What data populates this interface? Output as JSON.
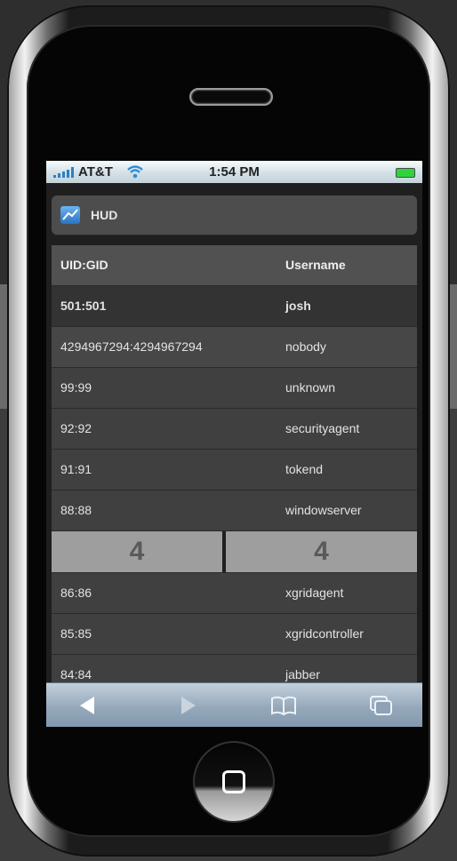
{
  "status_bar": {
    "carrier": "AT&T",
    "time": "1:54 PM",
    "icons": [
      "signal-bars-icon",
      "wifi-icon",
      "battery-icon"
    ]
  },
  "header": {
    "icon": "chart-icon",
    "title": "HUD"
  },
  "table": {
    "columns": [
      "UID:GID",
      "Username"
    ],
    "rows_top": [
      {
        "uid_gid": "501:501",
        "username": "josh"
      },
      {
        "uid_gid": "4294967294:4294967294",
        "username": "nobody"
      },
      {
        "uid_gid": "99:99",
        "username": "unknown"
      },
      {
        "uid_gid": "92:92",
        "username": "securityagent"
      },
      {
        "uid_gid": "91:91",
        "username": "tokend"
      },
      {
        "uid_gid": "88:88",
        "username": "windowserver"
      }
    ],
    "pager": {
      "left": "4",
      "right": "4"
    },
    "rows_bottom": [
      {
        "uid_gid": "86:86",
        "username": "xgridagent"
      },
      {
        "uid_gid": "85:85",
        "username": "xgridcontroller"
      },
      {
        "uid_gid": "84:84",
        "username": "jabber"
      }
    ]
  },
  "toolbar": {
    "buttons": [
      "back-arrow-icon",
      "forward-arrow-icon",
      "bookmarks-book-icon",
      "pages-icon"
    ]
  },
  "colors": {
    "status_bar": "#d3e0e6",
    "toolbar": "#95a8bb",
    "pager_cell": "#9e9e9e",
    "accent_blue": "#2a73c2"
  }
}
